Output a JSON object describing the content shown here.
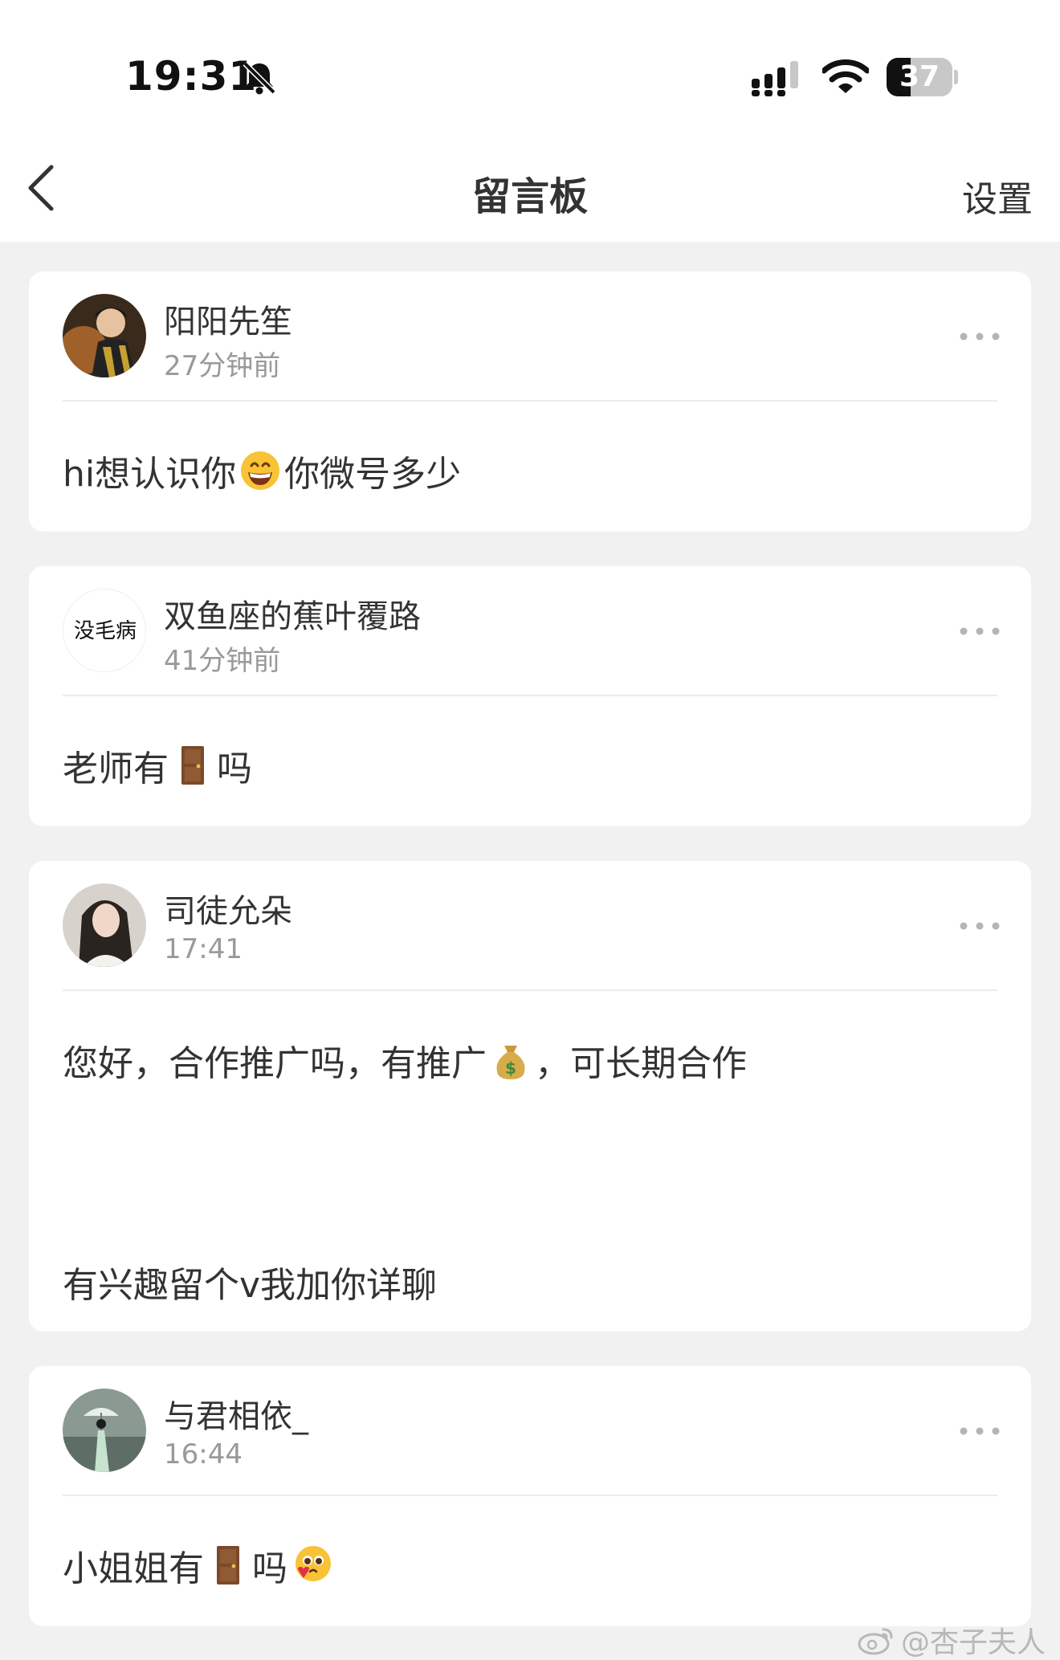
{
  "status_bar": {
    "time": "19:31",
    "battery_percent": "37",
    "battery_level": 0.37,
    "icons": [
      "bell-muted-icon",
      "signal-icon",
      "wifi-icon",
      "battery-icon"
    ]
  },
  "nav": {
    "back_icon": "chevron-left-icon",
    "title": "留言板",
    "settings_label": "设置"
  },
  "colors": {
    "background": "#f1f1f1",
    "card": "#ffffff",
    "primary_text": "#333333",
    "secondary_text": "#999999"
  },
  "messages": [
    {
      "name": "阳阳先笙",
      "time": "27分钟前",
      "text_parts": [
        "hi想认识你",
        "你微号多少"
      ],
      "emoji": "grinning-face-emoji"
    },
    {
      "name": "双鱼座的蕉叶覆路",
      "time": "41分钟前",
      "avatar_text": "没毛病",
      "text_parts": [
        "老师有",
        "吗"
      ],
      "emoji": "door-emoji"
    },
    {
      "name": "司徒允朵",
      "time": "17:41",
      "text_parts": [
        "您好，合作推广吗，有推广",
        "，可长期合作"
      ],
      "emoji": "money-bag-emoji",
      "text_line2": "有兴趣留个v我加你详聊"
    },
    {
      "name": "与君相依_",
      "time": "16:44",
      "text_parts": [
        "小姐姐有",
        "吗"
      ],
      "emoji": "door-emoji",
      "emoji2": "pleading-face-emoji"
    }
  ],
  "watermark": "@杏子夫人"
}
